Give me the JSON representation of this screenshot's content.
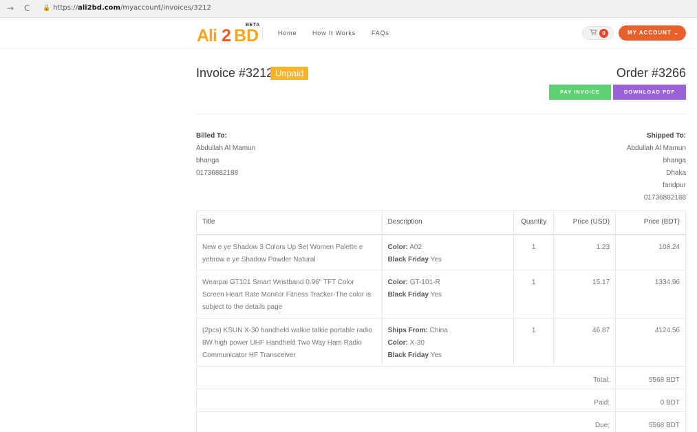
{
  "browser": {
    "back": "→",
    "reload": "C",
    "lock": "🔒",
    "url_prefix": "https://",
    "url_domain": "ali2bd.com",
    "url_path": "/myaccount/invoices/3212"
  },
  "header": {
    "logo": {
      "ali": "Ali",
      "two": "2",
      "bd": "BD",
      "beta": "BETA"
    },
    "menu": [
      "Home",
      "How It Works",
      "FAQs"
    ],
    "cart_count": "0",
    "account_label": "MY ACCOUNT",
    "account_chevron": "⌄"
  },
  "invoice": {
    "title": "Invoice #3212",
    "status": "Unpaid",
    "order": "Order #3266",
    "pay_button": "PAY INVOICE",
    "pdf_button": "DOWNLOAD PDF"
  },
  "billed_to": {
    "heading": "Billed To:",
    "lines": [
      "Abdullah Al Mamun",
      "bhanga",
      "01736882188"
    ]
  },
  "shipped_to": {
    "heading": "Shipped To:",
    "lines": [
      "Abdullah Al Mamun",
      "bhanga",
      "Dhaka",
      "faridpur",
      "01736882188"
    ]
  },
  "table": {
    "headers": [
      "Title",
      "Description",
      "Quantity",
      "Price (USD)",
      "Price (BDT)"
    ],
    "rows": [
      {
        "title": "New e ye Shadow 3 Colors Up Set Women Palette e yebrow e ye Shadow Powder Natural",
        "desc": [
          {
            "key": "Color:",
            "val": " A02"
          },
          {
            "key": "Black Friday",
            "val": " Yes"
          }
        ],
        "qty": "1",
        "usd": "1.23",
        "bdt": "108.24"
      },
      {
        "title": "Wearpai GT101 Smart Wristband 0.96\" TFT Color Screen Heart Rate Monitor Fitness Tracker-The color is subject to the details page",
        "desc": [
          {
            "key": "Color:",
            "val": " GT-101-R"
          },
          {
            "key": "Black Friday",
            "val": " Yes"
          }
        ],
        "qty": "1",
        "usd": "15.17",
        "bdt": "1334.96"
      },
      {
        "title": "(2pcs) KSUN X-30 handheld walkie talkie portable radio 8W high power UHF Handheld Two Way Ham Radio Communicator HF Transceiver",
        "desc": [
          {
            "key": "Ships From:",
            "val": " China"
          },
          {
            "key": "Color:",
            "val": " X-30"
          },
          {
            "key": "Black Friday",
            "val": " Yes"
          }
        ],
        "qty": "1",
        "usd": "46.87",
        "bdt": "4124.56"
      }
    ],
    "totals": [
      {
        "label": "Total:",
        "value": "5568 BDT"
      },
      {
        "label": "Paid:",
        "value": "0 BDT"
      },
      {
        "label": "Due:",
        "value": "5568 BDT"
      }
    ]
  },
  "colors": {
    "unpaid_badge": "#f7b32b",
    "pay_button": "#5fd072",
    "pdf_button": "#9a62d6",
    "account_button": "#e8612c",
    "logo_orange": "#f6a51f",
    "logo_red": "#ea5b28"
  }
}
